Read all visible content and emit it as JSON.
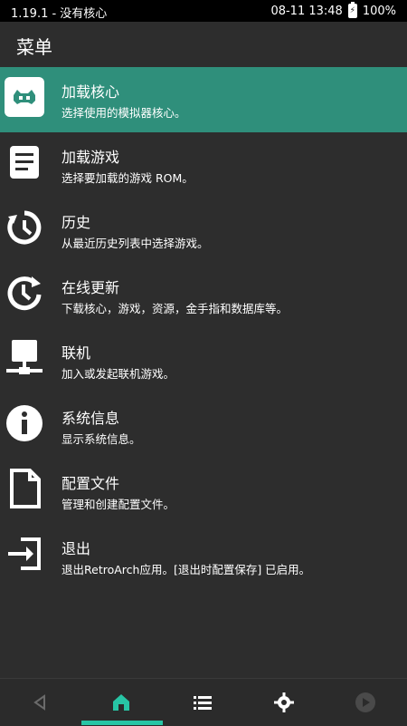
{
  "status": {
    "left": "1.19.1 - 没有核心",
    "datetime": "08-11 13:48",
    "battery": "100%"
  },
  "header": {
    "title": "菜单"
  },
  "menu": [
    {
      "title": "加载核心",
      "subtitle": "选择使用的模拟器核心。",
      "icon": "retroarch-invader-icon",
      "active": true
    },
    {
      "title": "加载游戏",
      "subtitle": "选择要加载的游戏 ROM。",
      "icon": "document-lines-icon"
    },
    {
      "title": "历史",
      "subtitle": "从最近历史列表中选择游戏。",
      "icon": "history-icon"
    },
    {
      "title": "在线更新",
      "subtitle": "下载核心，游戏，资源，金手指和数据库等。",
      "icon": "refresh-clock-icon"
    },
    {
      "title": "联机",
      "subtitle": "加入或发起联机游戏。",
      "icon": "network-monitor-icon"
    },
    {
      "title": "系统信息",
      "subtitle": "显示系统信息。",
      "icon": "info-icon"
    },
    {
      "title": "配置文件",
      "subtitle": "管理和创建配置文件。",
      "icon": "file-icon"
    },
    {
      "title": "退出",
      "subtitle": "退出RetroArch应用。[退出时配置保存] 已启用。",
      "icon": "exit-icon"
    }
  ],
  "bottom_nav": [
    {
      "name": "back-icon"
    },
    {
      "name": "home-icon",
      "active": true
    },
    {
      "name": "list-icon"
    },
    {
      "name": "settings-icon"
    },
    {
      "name": "play-icon"
    }
  ],
  "colors": {
    "accent": "#2f8f7b",
    "indicator": "#27c5a5",
    "background": "#2d2d2d"
  }
}
